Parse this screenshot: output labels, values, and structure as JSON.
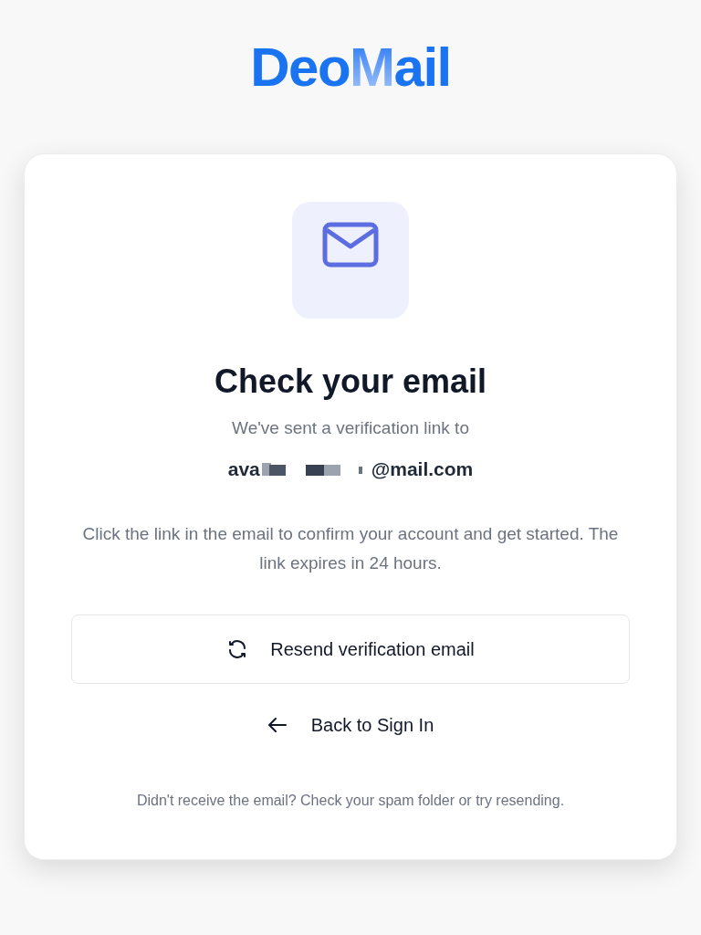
{
  "logo": {
    "lead": "Deo",
    "mark": "M",
    "tail": "ail"
  },
  "card": {
    "title": "Check your email",
    "subtitle": "We've sent a verification link to",
    "email": {
      "start": "ava",
      "end": "@mail.com",
      "redacted": true
    },
    "message": "Click the link in the email to confirm your account and get started. The link expires in 24 hours.",
    "resend_button": "Resend verification email",
    "back_link": "Back to Sign In",
    "footnote": "Didn't receive the email? Check your spam folder or try resending."
  }
}
